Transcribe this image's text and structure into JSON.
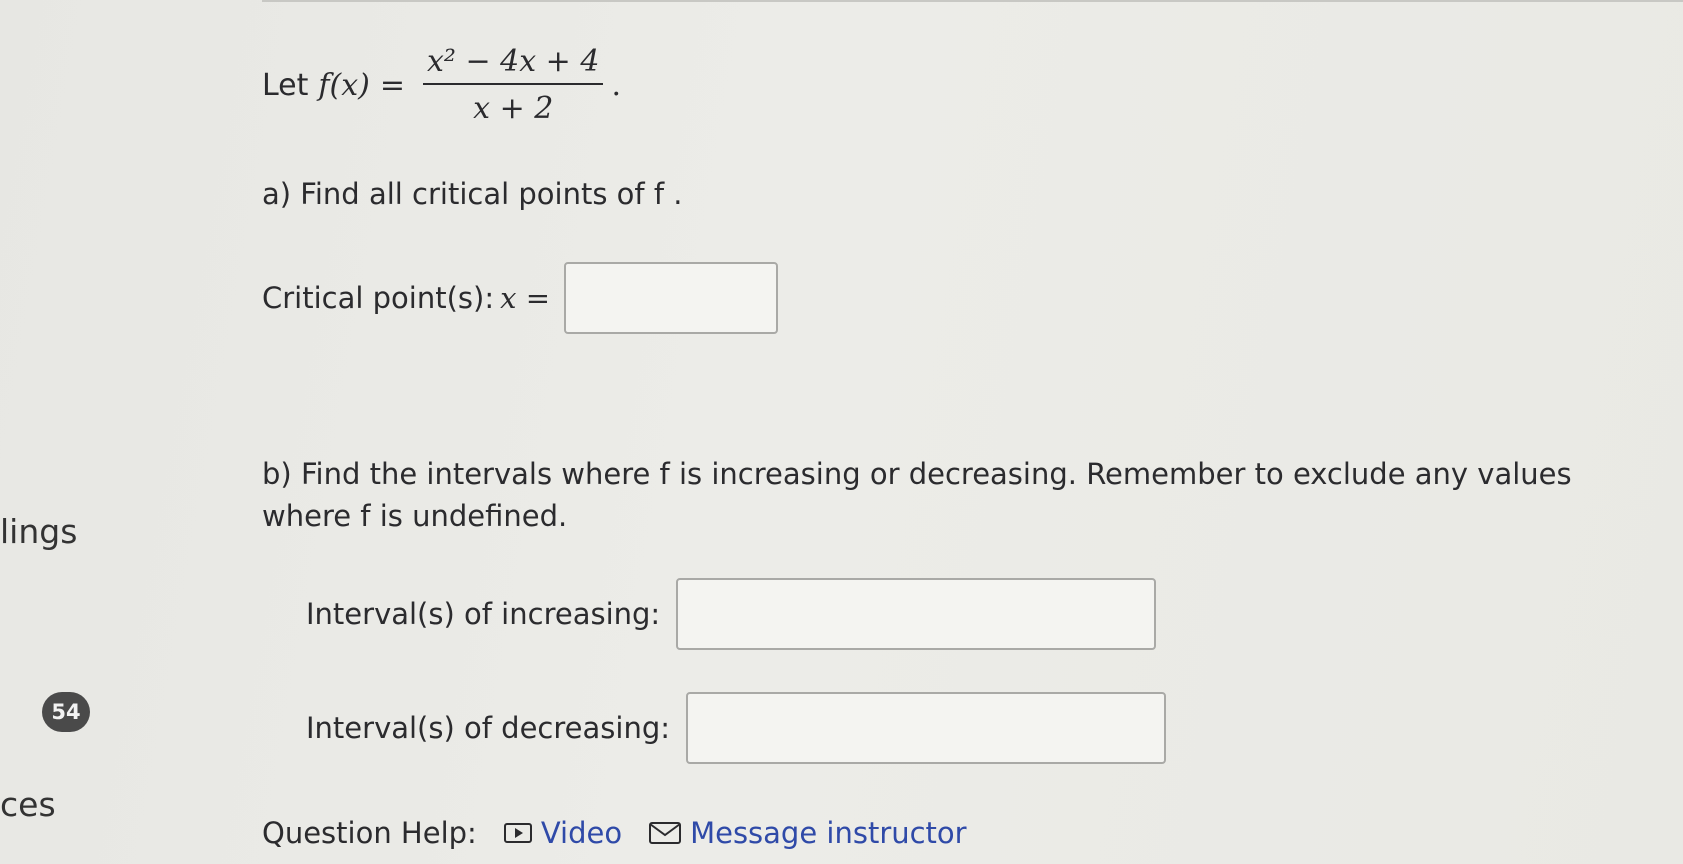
{
  "sidebar": {
    "fragment_top": "lings",
    "badge": "54",
    "fragment_bottom": "ces"
  },
  "problem": {
    "let": "Let",
    "func": "f(x)",
    "equals": "=",
    "numerator": "x² − 4x + 4",
    "denominator": "x + 2",
    "period": "."
  },
  "part_a": {
    "prompt": "a)  Find all critical points of f .",
    "critical_label": "Critical point(s): ",
    "critical_var": "x =",
    "critical_value": ""
  },
  "part_b": {
    "prompt": "b)  Find the intervals where f  is increasing or decreasing.  Remember to exclude any values where f is undefined.",
    "increasing_label": "Interval(s) of increasing:",
    "increasing_value": "",
    "decreasing_label": "Interval(s) of decreasing:",
    "decreasing_value": ""
  },
  "help": {
    "label": "Question Help:",
    "video": "Video",
    "message": "Message instructor"
  },
  "icons": {
    "video": "play-icon",
    "message": "envelope-icon"
  },
  "colors": {
    "link": "#2f4aa8",
    "badge_bg": "#4a4a4a"
  }
}
